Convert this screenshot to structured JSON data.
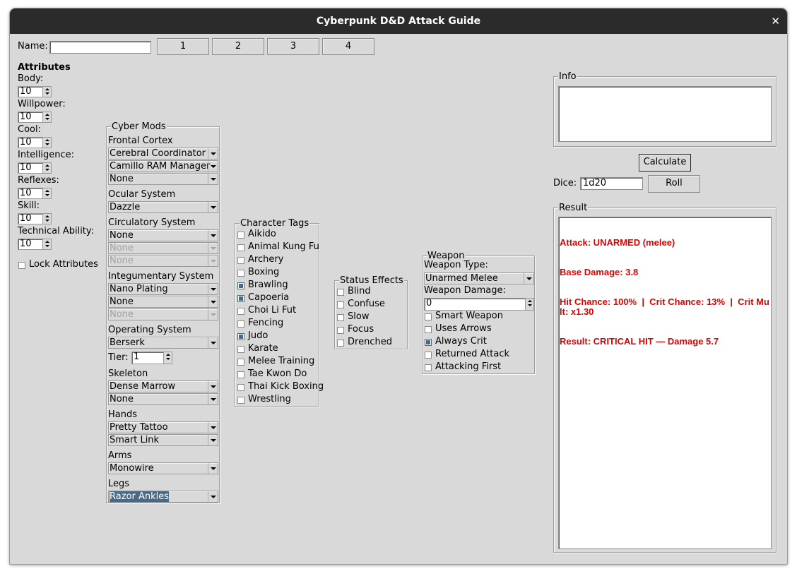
{
  "window": {
    "title": "Cyberpunk D&D Attack Guide",
    "close": "✕"
  },
  "top": {
    "name_label": "Name:",
    "name_value": "",
    "slot_buttons": [
      "1",
      "2",
      "3",
      "4"
    ]
  },
  "attributes": {
    "heading": "Attributes",
    "items": [
      {
        "label": "Body:",
        "value": "10"
      },
      {
        "label": "Willpower:",
        "value": "10"
      },
      {
        "label": "Cool:",
        "value": "10"
      },
      {
        "label": "Intelligence:",
        "value": "10"
      },
      {
        "label": "Reflexes:",
        "value": "10"
      },
      {
        "label": "Skill:",
        "value": "10"
      },
      {
        "label": "Technical Ability:",
        "value": "10"
      }
    ],
    "lock_label": "Lock Attributes",
    "lock_checked": false
  },
  "cyber": {
    "title": "Cyber Mods",
    "frontal_label": "Frontal Cortex",
    "frontal": [
      "Cerebral Coordinator",
      "Camillo RAM Manager",
      "None"
    ],
    "ocular_label": "Ocular System",
    "ocular": [
      "Dazzle"
    ],
    "circ_label": "Circulatory System",
    "circ": [
      "None",
      "None",
      "None"
    ],
    "integ_label": "Integumentary System",
    "integ": [
      "Nano Plating",
      "None",
      "None"
    ],
    "os_label": "Operating System",
    "os": [
      "Berserk"
    ],
    "tier_label": "Tier:",
    "tier_value": "1",
    "skeleton_label": "Skeleton",
    "skeleton": [
      "Dense Marrow",
      "None"
    ],
    "hands_label": "Hands",
    "hands": [
      "Pretty Tattoo",
      "Smart Link"
    ],
    "arms_label": "Arms",
    "arms": [
      "Monowire"
    ],
    "legs_label": "Legs",
    "legs": [
      "Razor Ankles"
    ]
  },
  "tags": {
    "title": "Character Tags",
    "items": [
      {
        "label": "Aikido",
        "checked": false
      },
      {
        "label": "Animal Kung Fu",
        "checked": false
      },
      {
        "label": "Archery",
        "checked": false
      },
      {
        "label": "Boxing",
        "checked": false
      },
      {
        "label": "Brawling",
        "checked": true
      },
      {
        "label": "Capoeria",
        "checked": true
      },
      {
        "label": "Choi Li Fut",
        "checked": false
      },
      {
        "label": "Fencing",
        "checked": false
      },
      {
        "label": "Judo",
        "checked": true
      },
      {
        "label": "Karate",
        "checked": false
      },
      {
        "label": "Melee Training",
        "checked": false
      },
      {
        "label": "Tae Kwon Do",
        "checked": false
      },
      {
        "label": "Thai Kick Boxing",
        "checked": false
      },
      {
        "label": "Wrestling",
        "checked": false
      }
    ]
  },
  "status": {
    "title": "Status Effects",
    "items": [
      {
        "label": "Blind",
        "checked": false
      },
      {
        "label": "Confuse",
        "checked": false
      },
      {
        "label": "Slow",
        "checked": false
      },
      {
        "label": "Focus",
        "checked": false
      },
      {
        "label": "Drenched",
        "checked": false
      }
    ]
  },
  "weapon": {
    "title": "Weapon",
    "type_label": "Weapon Type:",
    "type_value": "Unarmed Melee",
    "damage_label": "Weapon Damage:",
    "damage_value": "0",
    "options": [
      {
        "label": "Smart Weapon",
        "checked": false
      },
      {
        "label": "Uses Arrows",
        "checked": false
      },
      {
        "label": "Always Crit",
        "checked": true
      },
      {
        "label": "Returned Attack",
        "checked": false
      },
      {
        "label": "Attacking First",
        "checked": false
      }
    ]
  },
  "info": {
    "title": "Info",
    "text": ""
  },
  "actions": {
    "calculate": "Calculate",
    "dice_label": "Dice:",
    "dice_value": "1d20",
    "roll": "Roll"
  },
  "result": {
    "title": "Result",
    "lines": [
      "Attack: UNARMED (melee)",
      "Base Damage: 3.8",
      "Hit Chance: 100%  |  Crit Chance: 13%  |  Crit Mult: x1.30",
      "Result: CRITICAL HIT — Damage 5.7"
    ]
  },
  "colors": {
    "background": "#d9d9d9",
    "titlebar": "#2b2b2b",
    "selection": "#4a6984",
    "result_text": "#e00000"
  }
}
